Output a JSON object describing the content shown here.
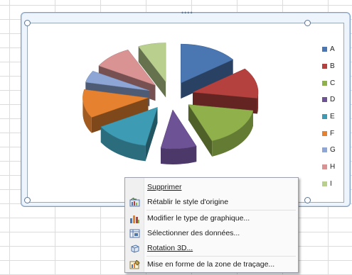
{
  "chart_data": {
    "type": "pie",
    "subtype": "3d-exploded",
    "categories": [
      "A",
      "B",
      "C",
      "D",
      "E",
      "F",
      "G",
      "H",
      "I"
    ],
    "values": [
      15,
      13,
      17,
      9,
      14,
      12,
      5,
      10,
      7
    ],
    "colors": [
      "#4a76b2",
      "#b5413e",
      "#8fb04a",
      "#6e5296",
      "#3d9bb3",
      "#e6822f",
      "#8ea6d5",
      "#d99393",
      "#b9cf8e"
    ],
    "legend_position": "right"
  },
  "legend": {
    "items": [
      "A",
      "B",
      "C",
      "D",
      "E",
      "F",
      "G",
      "H",
      "I"
    ]
  },
  "context_menu": {
    "items": [
      {
        "label": "Supprimer",
        "icon": "none"
      },
      {
        "label": "Rétablir le style d'origine",
        "icon": "reset-style-icon"
      },
      {
        "label": "Modifier le type de graphique...",
        "icon": "chart-type-icon"
      },
      {
        "label": "Sélectionner des données...",
        "icon": "select-data-icon"
      },
      {
        "label": "Rotation 3D...",
        "icon": "rotation-3d-icon"
      },
      {
        "label": "Mise en forme de la zone de traçage...",
        "icon": "format-plot-area-icon"
      }
    ]
  }
}
